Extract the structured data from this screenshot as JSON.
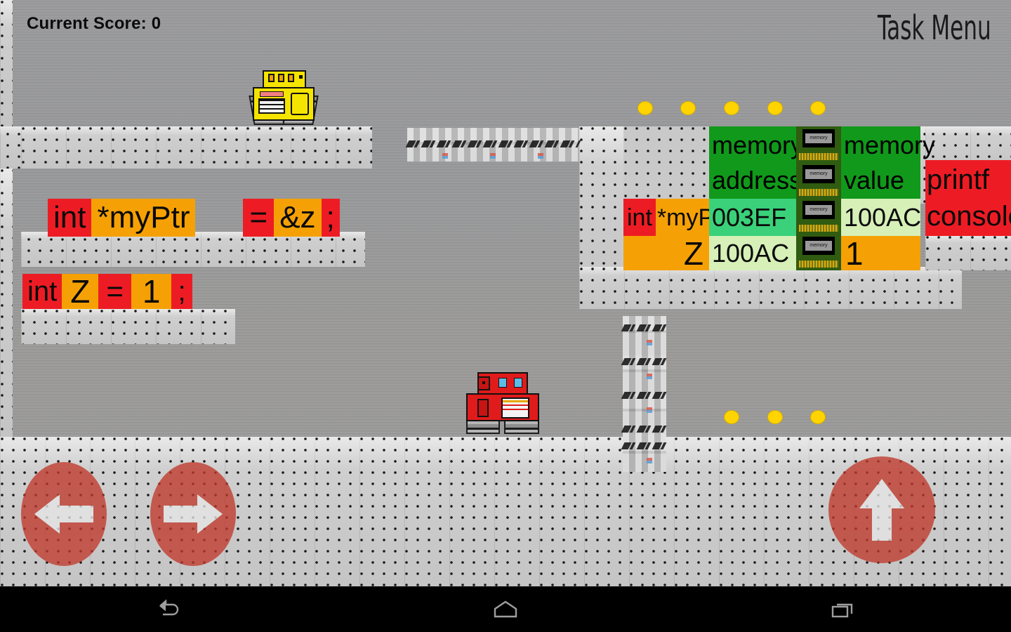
{
  "hud": {
    "score_label": "Current Score: 0",
    "task_menu_label": "Task Menu"
  },
  "code_lines": [
    {
      "id": "pointer-declaration",
      "tokens": [
        {
          "text": "int",
          "type": "kw"
        },
        {
          "text": "*myPtr",
          "type": "id"
        },
        {
          "text": "=",
          "type": "kw"
        },
        {
          "text": "&z",
          "type": "id"
        },
        {
          "text": ";",
          "type": "kw"
        }
      ]
    },
    {
      "id": "int-declaration",
      "tokens": [
        {
          "text": "int",
          "type": "kw"
        },
        {
          "text": "Z",
          "type": "id"
        },
        {
          "text": "=",
          "type": "kw"
        },
        {
          "text": "1",
          "type": "id"
        },
        {
          "text": ";",
          "type": "kw"
        }
      ]
    }
  ],
  "memory_table": {
    "headers": {
      "variable": "",
      "address": "memory address",
      "value": "memory value"
    },
    "address_header_line1": "memory",
    "address_header_line2": "address",
    "value_header_line1": "memory",
    "value_header_line2": "value",
    "chip_label": "memory",
    "rows": [
      {
        "type_keyword": "int",
        "variable": "*myPtr",
        "address": "003EF",
        "value": "100AC"
      },
      {
        "type_keyword": "",
        "variable": "Z",
        "address": "100AC",
        "value": "1"
      }
    ]
  },
  "console_panel": {
    "line1": "printf",
    "line2": "console"
  },
  "coins": {
    "top_row_count": 5,
    "bottom_row_count": 3
  },
  "robots": [
    {
      "name": "yellow-robot",
      "color": "#f5e400"
    },
    {
      "name": "red-robot-player",
      "color": "#e01b1b"
    }
  ],
  "controls": {
    "left_label": "left-arrow",
    "right_label": "right-arrow",
    "jump_label": "up-arrow",
    "button_color": "#c0392b"
  },
  "navbar": {
    "back_label": "back",
    "home_label": "home",
    "recents_label": "recents"
  }
}
